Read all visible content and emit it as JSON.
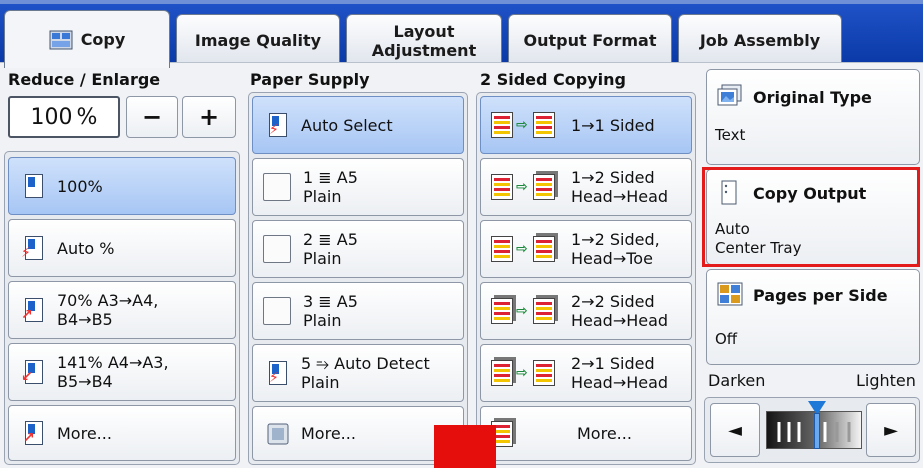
{
  "tabs": [
    {
      "label": "Copy",
      "active": true
    },
    {
      "label": "Image Quality",
      "active": false
    },
    {
      "label": "Layout\nAdjustment",
      "active": false
    },
    {
      "label": "Output Format",
      "active": false
    },
    {
      "label": "Job Assembly",
      "active": false
    }
  ],
  "reduce_enlarge": {
    "title": "Reduce / Enlarge",
    "value": "100",
    "unit": "%",
    "minus_label": "−",
    "plus_label": "+",
    "options": [
      {
        "label": "100%",
        "selected": true
      },
      {
        "label": "Auto %",
        "selected": false
      },
      {
        "label": "70% A3→A4,\nB4→B5",
        "selected": false
      },
      {
        "label": "141% A4→A3,\nB5→B4",
        "selected": false
      },
      {
        "label": "More...",
        "selected": false
      }
    ]
  },
  "paper_supply": {
    "title": "Paper Supply",
    "options": [
      {
        "line1": "Auto Select",
        "line2": "",
        "selected": true
      },
      {
        "line1": "1 ≣ A5",
        "line2": "Plain",
        "selected": false
      },
      {
        "line1": "2 ≣ A5",
        "line2": "Plain",
        "selected": false
      },
      {
        "line1": "3 ≣ A5",
        "line2": "Plain",
        "selected": false
      },
      {
        "line1": "5 ⥱ Auto Detect",
        "line2": "Plain",
        "selected": false
      },
      {
        "line1": "More...",
        "line2": "",
        "selected": false
      }
    ]
  },
  "two_sided": {
    "title": "2 Sided Copying",
    "options": [
      {
        "line1": "1→1 Sided",
        "line2": "",
        "selected": true
      },
      {
        "line1": "1→2 Sided",
        "line2": "Head→Head",
        "selected": false
      },
      {
        "line1": "1→2 Sided,",
        "line2": "Head→Toe",
        "selected": false
      },
      {
        "line1": "2→2 Sided",
        "line2": "Head→Head",
        "selected": false
      },
      {
        "line1": "2→1 Sided",
        "line2": "Head→Head",
        "selected": false
      },
      {
        "line1": "More...",
        "line2": "",
        "selected": false
      }
    ]
  },
  "side_panel": {
    "original_type": {
      "title": "Original Type",
      "value": "Text"
    },
    "copy_output": {
      "title": "Copy Output",
      "value1": "Auto",
      "value2": "Center Tray"
    },
    "pages_per_side": {
      "title": "Pages per Side",
      "value": "Off"
    },
    "darken_label": "Darken",
    "lighten_label": "Lighten",
    "left_arrow": "◄",
    "right_arrow": "►",
    "density_level": 0.5
  },
  "colors": {
    "tabbar": "#0b3aa8",
    "selected": "#a7c6f4",
    "highlight": "#e41b1b"
  }
}
